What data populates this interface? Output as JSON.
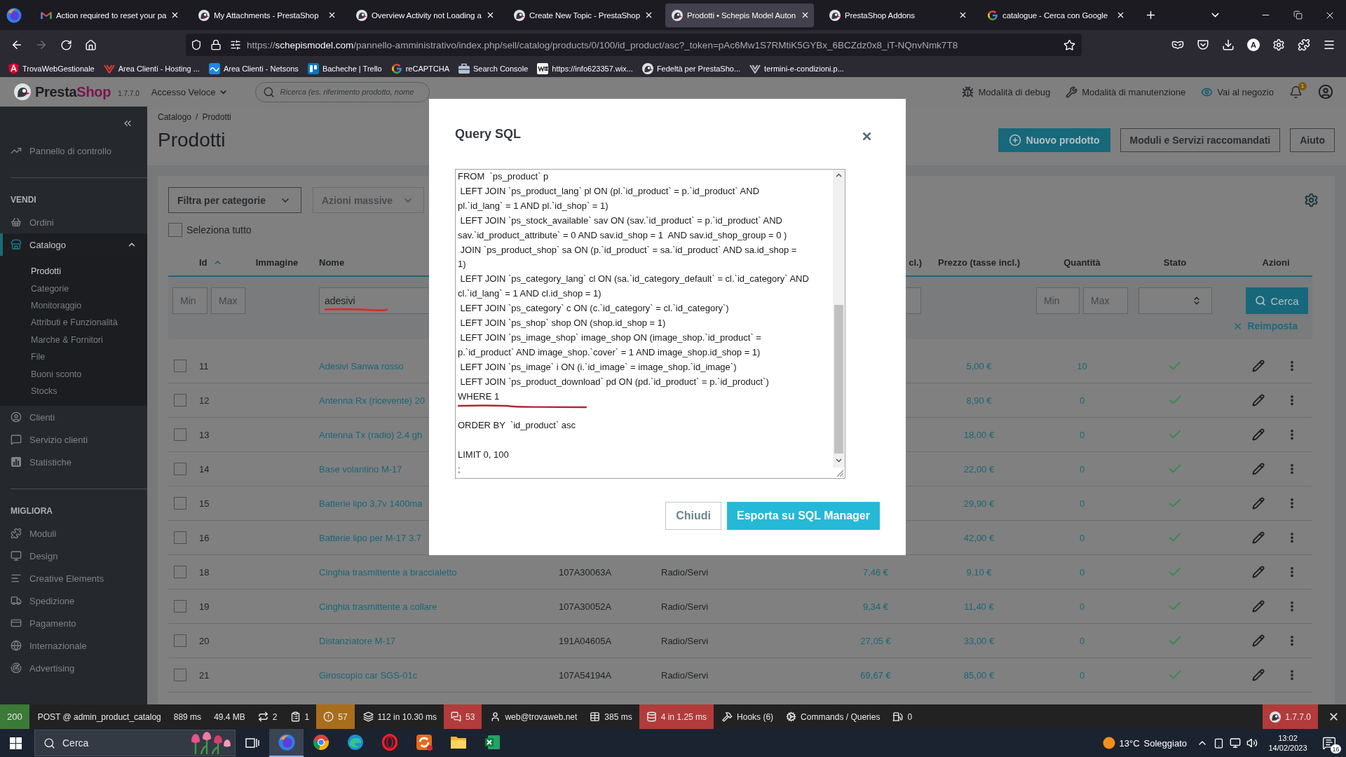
{
  "browser": {
    "tabs": [
      {
        "title": "Action required to reset your pa",
        "selected": false
      },
      {
        "title": "My Attachments - PrestaShop",
        "selected": false
      },
      {
        "title": "Overview Activity not Loading a",
        "selected": false
      },
      {
        "title": "Create New Topic - PrestaShop",
        "selected": false
      },
      {
        "title": "Prodotti • Schepis Model Auton",
        "selected": true
      },
      {
        "title": "PrestaShop Addons",
        "selected": false
      },
      {
        "title": "catalogue - Cerca con Google",
        "selected": false
      }
    ],
    "address": {
      "scheme": "https://",
      "host": "schepismodel.com",
      "path": "/pannello-amministrativo/index.php/sell/catalog/products/0/100/id_product/asc?_token=pAc6Mw1S7RMtiK5GYBx_6BCZdz0x8_iT-NQnvNmk7T8"
    },
    "profile_initial": "A",
    "bookmarks": [
      "TrovaWebGestionale",
      "Area Clienti - Hosting ...",
      "Area Clienti - Netsons",
      "Bacheche | Trello",
      "reCAPTCHA",
      "Search Console",
      "https://info623357.wix...",
      "Fedeltà per PrestaSho...",
      "termini-e-condizioni.p..."
    ]
  },
  "admin_header": {
    "brand": {
      "part_1": "Presta",
      "part_2": "Shop"
    },
    "version": "1.7.7.0",
    "quick_access": "Accesso Veloce",
    "search": {
      "placeholder": "Ricerca (es. riferimento prodotto, nome"
    },
    "links": [
      "Modalità di debug",
      "Modalità di manutenzione",
      "Vai al negozio"
    ],
    "notification_count": "1"
  },
  "sidebar": {
    "sections": [
      {
        "items": [
          {
            "label": "Pannello di controllo",
            "selected": false
          }
        ]
      },
      {
        "heading": "VENDI",
        "items": [
          {
            "label": "Ordini",
            "selected": false
          },
          {
            "label": "Catalogo",
            "selected": true,
            "expanded": true,
            "children": [
              {
                "label": "Prodotti",
                "selected": true
              },
              {
                "label": "Categorie",
                "selected": false
              },
              {
                "label": "Monitoraggio",
                "selected": false
              },
              {
                "label": "Attributi e Funzionalità",
                "selected": false
              },
              {
                "label": "Marche & Fornitori",
                "selected": false
              },
              {
                "label": "File",
                "selected": false
              },
              {
                "label": "Buoni sconto",
                "selected": false
              },
              {
                "label": "Stocks",
                "selected": false
              }
            ]
          },
          {
            "label": "Clienti",
            "selected": false
          },
          {
            "label": "Servizio clienti",
            "selected": false
          },
          {
            "label": "Statistiche",
            "selected": false
          }
        ]
      },
      {
        "heading": "MIGLIORA",
        "items": [
          {
            "label": "Moduli",
            "selected": false
          },
          {
            "label": "Design",
            "selected": false
          },
          {
            "label": "Creative Elements",
            "selected": false
          },
          {
            "label": "Spedizione",
            "selected": false
          },
          {
            "label": "Pagamento",
            "selected": false
          },
          {
            "label": "Internazionale",
            "selected": false
          },
          {
            "label": "Advertising",
            "selected": false
          }
        ]
      }
    ]
  },
  "page": {
    "breadcrumb": {
      "items": [
        "Catalogo",
        "Prodotti"
      ],
      "separator": "/"
    },
    "title": "Prodotti",
    "actions": [
      {
        "label": "Nuovo prodotto",
        "kind": "primary"
      },
      {
        "label": "Moduli e Servizi raccomandati",
        "kind": "outline"
      },
      {
        "label": "Aiuto",
        "kind": "outline"
      }
    ]
  },
  "products": {
    "category_filter": "Filtra per categorie",
    "bulk_actions": {
      "label": "Azioni massive",
      "disabled": true
    },
    "select_all": {
      "label": "Seleziona tutto",
      "checked": false
    },
    "columns": [
      {
        "label": "Id",
        "sorted": true
      },
      {
        "label": "Immagine"
      },
      {
        "label": "Nome"
      },
      {
        "label": "cl.)"
      },
      {
        "label": "Prezzo (tasse incl.)"
      },
      {
        "label": "Quantità"
      },
      {
        "label": "Stato"
      },
      {
        "label": "Azioni"
      }
    ],
    "filters": {
      "id_min": {
        "placeholder": "Min"
      },
      "id_max": {
        "placeholder": "Max"
      },
      "name": {
        "value": "adesivi"
      },
      "quantity_min": {
        "placeholder": "Min"
      },
      "quantity_max": {
        "placeholder": "Max"
      },
      "search_button": "Cerca",
      "reset": "Reimposta"
    },
    "rows": [
      {
        "id": "11",
        "name": "Adesivi Sanwa rosso",
        "price_incl": "5,00 €",
        "quantity": "10",
        "active": true,
        "checked": false
      },
      {
        "id": "12",
        "name": "Antenna Rx (ricevente) 20",
        "price_incl": "8,90 €",
        "quantity": "0",
        "active": true,
        "checked": false
      },
      {
        "id": "13",
        "name": "Antenna Tx (radio) 2.4 gh",
        "price_incl": "18,00 €",
        "quantity": "0",
        "active": true,
        "checked": false
      },
      {
        "id": "14",
        "name": "Base volantino M-17",
        "price_incl": "22,00 €",
        "quantity": "0",
        "active": true,
        "checked": false
      },
      {
        "id": "15",
        "name": "Batterie lipo 3,7v 1400ma",
        "price_incl": "29,90 €",
        "quantity": "0",
        "active": true,
        "checked": false
      },
      {
        "id": "16",
        "name": "Batterie lipo per M-17 3.7",
        "price_incl": "42,00 €",
        "quantity": "0",
        "active": true,
        "checked": false
      },
      {
        "id": "18",
        "name": "Cinghia trasmittente a braccialetto",
        "reference": "107A30063A",
        "category": "Radio/Servi",
        "price_excl": "7,46 €",
        "price_incl": "9,10 €",
        "quantity": "0",
        "active": true,
        "checked": false
      },
      {
        "id": "19",
        "name": "Cinghia trasmittente a collare",
        "reference": "107A30052A",
        "category": "Radio/Servi",
        "price_excl": "9,34 €",
        "price_incl": "11,40 €",
        "quantity": "0",
        "active": true,
        "checked": false
      },
      {
        "id": "20",
        "name": "Distanziatore M-17",
        "reference": "191A04605A",
        "category": "Radio/Servi",
        "price_excl": "27,05 €",
        "price_incl": "33,00 €",
        "quantity": "0",
        "active": true,
        "checked": false
      },
      {
        "id": "21",
        "name": "Giroscopio car SGS-01c",
        "reference": "107A54194A",
        "category": "Radio/Servi",
        "price_excl": "69,67 €",
        "price_incl": "85,00 €",
        "quantity": "0",
        "active": true,
        "checked": false
      }
    ]
  },
  "modal": {
    "title": "Query SQL",
    "query": [
      [
        "FROM  `ps_product` p",
        " LEFT JOIN `ps_product_lang` pl ON (pl.`id_product` = p.`id_product` AND",
        "pl.`id_lang` = 1 AND pl.`id_shop` = 1)",
        " LEFT JOIN `ps_stock_available` sav ON (sav.`id_product` = p.`id_product` AND",
        "sav.`id_product_attribute` = 0 AND sav.id_shop = 1  AND sav.id_shop_group = 0 )",
        " JOIN `ps_product_shop` sa ON (p.`id_product` = sa.`id_product` AND sa.id_shop =",
        "1)",
        " LEFT JOIN `ps_category_lang` cl ON (sa.`id_category_default` = cl.`id_category` AND",
        "cl.`id_lang` = 1 AND cl.id_shop = 1)",
        " LEFT JOIN `ps_category` c ON (c.`id_category` = cl.`id_category`)",
        " LEFT JOIN `ps_shop` shop ON (shop.id_shop = 1)",
        " LEFT JOIN `ps_image_shop` image_shop ON (image_shop.`id_product` =",
        "p.`id_product` AND image_shop.`cover` = 1 AND image_shop.id_shop = 1)",
        " LEFT JOIN `ps_image` i ON (i.`id_image` = image_shop.`id_image`)",
        " LEFT JOIN `ps_product_download` pd ON (pd.`id_product` = p.`id_product`)",
        "WHERE 1"
      ],
      [
        "ORDER BY  `id_product` asc"
      ],
      [
        "LIMIT 0, 100",
        ";"
      ]
    ],
    "buttons": [
      {
        "label": "Chiudi",
        "kind": "secondary"
      },
      {
        "label": "Esporta su SQL Manager",
        "kind": "primary"
      }
    ]
  },
  "debug_bar": {
    "items": [
      {
        "text": "200",
        "color": "#3b7a37"
      },
      {
        "text": "POST @ admin_product_catalog"
      },
      {
        "text": "889 ms"
      },
      {
        "text": "49.4 MB"
      },
      {
        "text": "2"
      },
      {
        "text": "1"
      },
      {
        "text": "57",
        "color": "#a86e1c"
      },
      {
        "text": "112 in 10.30 ms"
      },
      {
        "text": "53",
        "color": "#b23b3b"
      },
      {
        "text": "web@trovaweb.net"
      },
      {
        "text": "385 ms"
      },
      {
        "text": "4 in 1.25 ms",
        "color": "#b23b3b"
      },
      {
        "text": "Hooks (6)"
      },
      {
        "text": "Commands / Queries"
      },
      {
        "text": "0"
      }
    ],
    "version": {
      "text": "1.7.7.0",
      "color": "#b23b3b"
    }
  },
  "taskbar": {
    "search": {
      "placeholder": "Cerca"
    },
    "apps": [
      {
        "active": true
      },
      {
        "active": false
      },
      {
        "active": false
      },
      {
        "active": false
      },
      {
        "active": false
      },
      {
        "active": false
      },
      {
        "active": false
      }
    ],
    "weather": {
      "temperature": "13°C",
      "condition": "Soleggiato"
    },
    "clock": {
      "time": "13:02",
      "date": "14/02/2023"
    },
    "notification_count": "16"
  }
}
